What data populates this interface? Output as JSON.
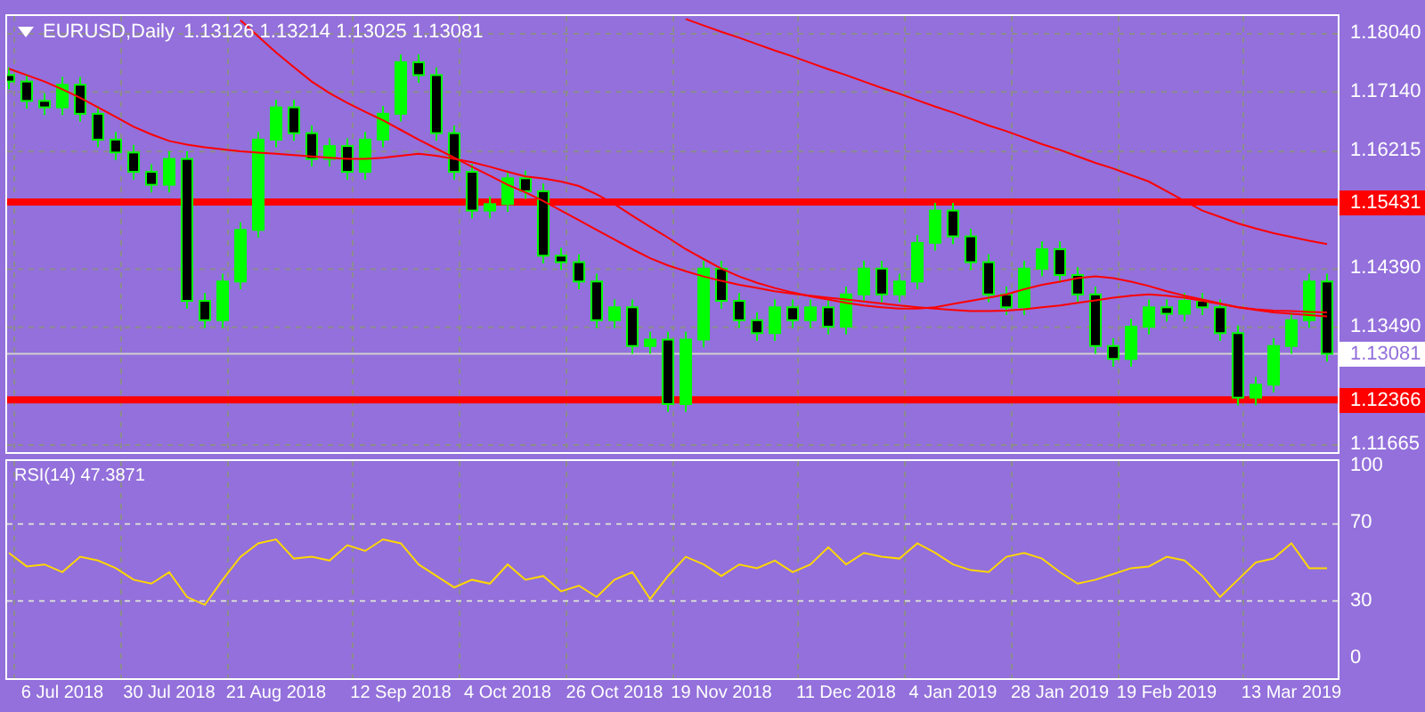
{
  "price_chart": {
    "header": {
      "title": "EURUSD,Daily",
      "quote": "1.13126 1.13214 1.13025 1.13081"
    },
    "chart_data": {
      "type": "candlestick",
      "ylim": [
        1.11555,
        1.18316
      ],
      "grid": true,
      "yticks": [
        {
          "value": 1.1804,
          "label": "1.18040"
        },
        {
          "value": 1.1714,
          "label": "1.17140"
        },
        {
          "value": 1.16215,
          "label": "1.16215"
        },
        {
          "value": 1.1439,
          "label": "1.14390"
        },
        {
          "value": 1.1349,
          "label": "1.13490"
        },
        {
          "value": 1.11665,
          "label": "1.11665"
        }
      ],
      "ohlc": [
        [
          1.174,
          1.1752,
          1.1718,
          1.173
        ],
        [
          1.173,
          1.1742,
          1.1688,
          1.17
        ],
        [
          1.17,
          1.1712,
          1.1678,
          1.169
        ],
        [
          1.169,
          1.1737,
          1.1678,
          1.1725
        ],
        [
          1.1725,
          1.1737,
          1.1668,
          1.168
        ],
        [
          1.168,
          1.1692,
          1.1628,
          1.164
        ],
        [
          1.164,
          1.1652,
          1.1608,
          1.162
        ],
        [
          1.162,
          1.1632,
          1.1578,
          1.159
        ],
        [
          1.159,
          1.1602,
          1.1558,
          1.157
        ],
        [
          1.157,
          1.1622,
          1.1558,
          1.161
        ],
        [
          1.161,
          1.1622,
          1.1378,
          1.139
        ],
        [
          1.139,
          1.1402,
          1.1348,
          1.136
        ],
        [
          1.136,
          1.1432,
          1.1348,
          1.142
        ],
        [
          1.142,
          1.1512,
          1.1408,
          1.15
        ],
        [
          1.15,
          1.1652,
          1.1488,
          1.164
        ],
        [
          1.164,
          1.1702,
          1.1628,
          1.169
        ],
        [
          1.169,
          1.1702,
          1.1638,
          1.165
        ],
        [
          1.165,
          1.1662,
          1.1598,
          1.161
        ],
        [
          1.161,
          1.1642,
          1.1598,
          1.163
        ],
        [
          1.163,
          1.1642,
          1.1578,
          1.159
        ],
        [
          1.159,
          1.1652,
          1.1578,
          1.164
        ],
        [
          1.164,
          1.1692,
          1.1628,
          1.168
        ],
        [
          1.168,
          1.1772,
          1.1668,
          1.176
        ],
        [
          1.176,
          1.1772,
          1.1728,
          1.174
        ],
        [
          1.174,
          1.1752,
          1.1638,
          1.165
        ],
        [
          1.165,
          1.1662,
          1.1578,
          1.159
        ],
        [
          1.159,
          1.1602,
          1.1518,
          1.153
        ],
        [
          1.153,
          1.1552,
          1.1518,
          1.154
        ],
        [
          1.154,
          1.1592,
          1.1528,
          1.158
        ],
        [
          1.158,
          1.1592,
          1.1548,
          1.156
        ],
        [
          1.156,
          1.1572,
          1.1448,
          1.146
        ],
        [
          1.146,
          1.1472,
          1.1438,
          1.145
        ],
        [
          1.145,
          1.1462,
          1.1408,
          1.142
        ],
        [
          1.142,
          1.1432,
          1.1348,
          1.136
        ],
        [
          1.136,
          1.1392,
          1.1348,
          1.138
        ],
        [
          1.138,
          1.1392,
          1.1308,
          1.132
        ],
        [
          1.132,
          1.1342,
          1.1308,
          1.133
        ],
        [
          1.133,
          1.1342,
          1.1218,
          1.123
        ],
        [
          1.123,
          1.1342,
          1.1218,
          1.133
        ],
        [
          1.133,
          1.1452,
          1.1318,
          1.144
        ],
        [
          1.144,
          1.1452,
          1.1378,
          1.139
        ],
        [
          1.139,
          1.1402,
          1.1348,
          1.136
        ],
        [
          1.136,
          1.1372,
          1.1328,
          1.134
        ],
        [
          1.134,
          1.1392,
          1.1328,
          1.138
        ],
        [
          1.138,
          1.1392,
          1.1348,
          1.136
        ],
        [
          1.136,
          1.1392,
          1.1348,
          1.138
        ],
        [
          1.138,
          1.1392,
          1.1338,
          1.135
        ],
        [
          1.135,
          1.1412,
          1.1338,
          1.14
        ],
        [
          1.14,
          1.1452,
          1.1388,
          1.144
        ],
        [
          1.144,
          1.1452,
          1.1388,
          1.14
        ],
        [
          1.14,
          1.1432,
          1.1388,
          1.142
        ],
        [
          1.142,
          1.1492,
          1.1408,
          1.148
        ],
        [
          1.148,
          1.1542,
          1.1468,
          1.153
        ],
        [
          1.153,
          1.1542,
          1.1478,
          1.149
        ],
        [
          1.149,
          1.1502,
          1.1438,
          1.145
        ],
        [
          1.145,
          1.1462,
          1.1388,
          1.14
        ],
        [
          1.14,
          1.1412,
          1.1368,
          1.138
        ],
        [
          1.138,
          1.1452,
          1.1368,
          1.144
        ],
        [
          1.144,
          1.1482,
          1.1428,
          1.147
        ],
        [
          1.147,
          1.1482,
          1.1418,
          1.143
        ],
        [
          1.143,
          1.1442,
          1.1388,
          1.14
        ],
        [
          1.14,
          1.1412,
          1.1308,
          1.132
        ],
        [
          1.132,
          1.1332,
          1.1288,
          1.13
        ],
        [
          1.13,
          1.1362,
          1.1288,
          1.135
        ],
        [
          1.135,
          1.1392,
          1.1338,
          1.138
        ],
        [
          1.138,
          1.1392,
          1.1358,
          1.137
        ],
        [
          1.137,
          1.1402,
          1.1358,
          1.139
        ],
        [
          1.139,
          1.1402,
          1.1368,
          1.138
        ],
        [
          1.138,
          1.1392,
          1.1328,
          1.134
        ],
        [
          1.134,
          1.1352,
          1.1228,
          1.124
        ],
        [
          1.124,
          1.1272,
          1.1228,
          1.126
        ],
        [
          1.126,
          1.1332,
          1.1248,
          1.132
        ],
        [
          1.132,
          1.1372,
          1.1308,
          1.136
        ],
        [
          1.136,
          1.1432,
          1.1348,
          1.142
        ],
        [
          1.142,
          1.1432,
          1.1296,
          1.1308
        ]
      ],
      "series": [
        {
          "type": "line",
          "color": "#ff0000",
          "values": [
            1.175,
            1.174,
            1.173,
            1.1718,
            1.1705,
            1.169,
            1.1675,
            1.166,
            1.1648,
            1.1638,
            1.1632,
            1.1628,
            1.1625,
            1.1622,
            1.162,
            1.1618,
            1.1616,
            1.1614,
            1.1612,
            1.161,
            1.161,
            1.1612,
            1.1615,
            1.1618,
            1.1615,
            1.161,
            1.1605,
            1.1598,
            1.159,
            1.1583,
            1.158,
            1.1575,
            1.1568,
            1.1555,
            1.154,
            1.1522,
            1.1505,
            1.1488,
            1.147,
            1.1455,
            1.144,
            1.1428,
            1.1418,
            1.141,
            1.1403,
            1.1397,
            1.1392,
            1.1387,
            1.1383,
            1.138,
            1.1378,
            1.1378,
            1.138,
            1.1385,
            1.139,
            1.1395,
            1.14,
            1.1408,
            1.1415,
            1.142,
            1.1425,
            1.1428,
            1.1425,
            1.142,
            1.1413,
            1.1405,
            1.1398,
            1.1392,
            1.1386,
            1.138,
            1.1376,
            1.1372,
            1.137,
            1.1368,
            1.1366
          ]
        },
        {
          "type": "line",
          "color": "#ff0000",
          "values": [
            null,
            null,
            null,
            null,
            null,
            null,
            null,
            null,
            null,
            null,
            null,
            null,
            null,
            1.1825,
            1.18,
            1.1775,
            1.1752,
            1.173,
            1.1712,
            1.1697,
            1.1683,
            1.167,
            1.1655,
            1.164,
            1.1626,
            1.1612,
            1.1598,
            1.1584,
            1.157,
            1.1558,
            1.1545,
            1.153,
            1.1515,
            1.15,
            1.1485,
            1.147,
            1.1456,
            1.1445,
            1.1436,
            1.1428,
            1.1421,
            1.1415,
            1.141,
            1.1405,
            1.1401,
            1.1398,
            1.1395,
            1.1392,
            1.1389,
            1.1386,
            1.1383,
            1.138,
            1.1378,
            1.1376,
            1.1374,
            1.1374,
            1.1375,
            1.1377,
            1.138,
            1.1383,
            1.1387,
            1.1391,
            1.1395,
            1.1398,
            1.14,
            1.1398,
            1.1395,
            1.139,
            1.1385,
            1.138,
            1.1377,
            1.1375,
            1.1374,
            1.1373,
            1.1372
          ]
        },
        {
          "type": "line",
          "color": "#ff0000",
          "values": [
            null,
            null,
            null,
            null,
            null,
            null,
            null,
            null,
            null,
            null,
            null,
            null,
            null,
            null,
            null,
            null,
            null,
            null,
            null,
            null,
            null,
            null,
            null,
            null,
            null,
            null,
            null,
            null,
            null,
            null,
            null,
            null,
            null,
            null,
            null,
            null,
            null,
            null,
            1.1827,
            1.1817,
            1.1807,
            1.1798,
            1.1788,
            1.1778,
            1.1769,
            1.1759,
            1.1749,
            1.174,
            1.173,
            1.172,
            1.1711,
            1.1701,
            1.1691,
            1.1682,
            1.1672,
            1.1662,
            1.1653,
            1.1643,
            1.1633,
            1.1624,
            1.1614,
            1.1604,
            1.1595,
            1.1585,
            1.1575,
            1.156,
            1.1545,
            1.153,
            1.152,
            1.151,
            1.1502,
            1.1495,
            1.1489,
            1.1483,
            1.1478
          ]
        }
      ],
      "ref_lines": [
        {
          "axis": "y",
          "value": 1.15431,
          "label": "1.15431",
          "color": "#ff0000"
        },
        {
          "axis": "y",
          "value": 1.13081,
          "label": "1.13081",
          "color": "#d0d0d0"
        },
        {
          "axis": "y",
          "value": 1.12366,
          "label": "1.12366",
          "color": "#ff0000"
        }
      ]
    }
  },
  "rsi_panel": {
    "label": "RSI(14) 47.3871",
    "chart_data": {
      "type": "line",
      "ylim": [
        -10.19,
        102.78
      ],
      "grid": true,
      "categories": [
        null,
        null,
        null,
        "6 Jul 2018",
        null,
        null,
        null,
        null,
        null,
        "30 Jul 2018",
        null,
        null,
        null,
        null,
        null,
        "21 Aug 2018",
        null,
        null,
        null,
        null,
        null,
        null,
        "12 Sep 2018",
        null,
        null,
        null,
        null,
        null,
        "4 Oct 2018",
        null,
        null,
        null,
        null,
        null,
        "26 Oct 2018",
        null,
        null,
        null,
        null,
        null,
        "19 Nov 2018",
        null,
        null,
        null,
        null,
        null,
        null,
        "11 Dec 2018",
        null,
        null,
        null,
        null,
        null,
        "4 Jan 2019",
        null,
        null,
        null,
        null,
        null,
        "28 Jan 2019",
        null,
        null,
        null,
        null,
        null,
        "19 Feb 2019",
        null,
        null,
        null,
        null,
        null,
        null,
        "13 Mar 2019",
        null,
        null
      ],
      "yticks": [
        {
          "value": 100,
          "label": "100"
        },
        {
          "value": 70,
          "label": "70"
        },
        {
          "value": 30,
          "label": "30"
        },
        {
          "value": 0,
          "label": "0"
        }
      ],
      "series": [
        {
          "color": "#ffd700",
          "values": [
            55,
            48,
            49,
            45,
            53,
            51,
            47,
            41,
            39,
            45,
            32,
            28,
            41,
            53,
            60,
            62,
            52,
            53,
            51,
            59,
            56,
            62,
            60,
            49,
            43,
            37,
            41,
            39,
            49,
            41,
            43,
            35,
            38,
            32,
            41,
            45,
            31,
            43,
            53,
            49,
            43,
            49,
            47,
            51,
            45,
            49,
            58,
            49,
            55,
            53,
            52,
            60,
            55,
            49,
            46,
            45,
            53,
            55,
            52,
            45,
            39,
            41,
            44,
            47,
            48,
            53,
            51,
            43,
            32,
            41,
            50,
            52,
            60,
            47,
            47
          ]
        }
      ]
    }
  }
}
